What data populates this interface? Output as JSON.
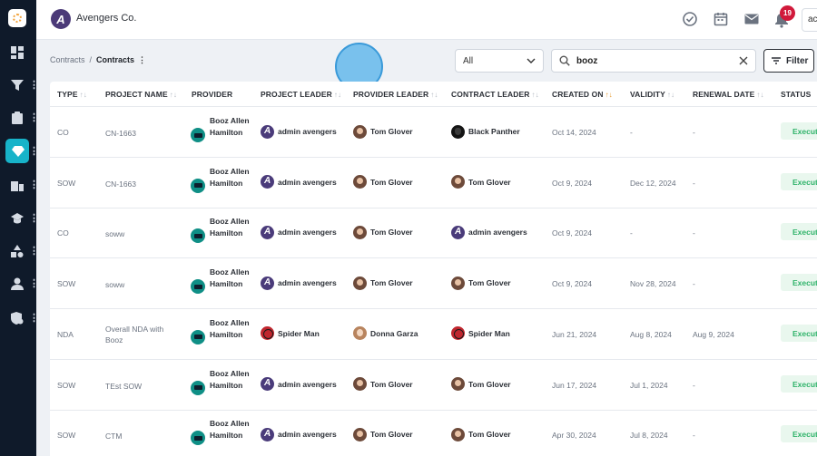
{
  "app": {
    "name": "Avengers Co."
  },
  "nav": {
    "items": [
      {
        "icon": "dashboard-icon"
      },
      {
        "icon": "funnel-icon"
      },
      {
        "icon": "clipboard-icon"
      },
      {
        "icon": "diamond-icon",
        "active": true
      },
      {
        "icon": "building-icon"
      },
      {
        "icon": "graduation-cap-icon"
      },
      {
        "icon": "shapes-icon"
      },
      {
        "icon": "user-icon"
      },
      {
        "icon": "shield-gear-icon"
      }
    ]
  },
  "header": {
    "notification_count": "19",
    "user_initials": "ac"
  },
  "breadcrumb": {
    "root": "Contracts",
    "separator": "/",
    "current": "Contracts"
  },
  "filters": {
    "type_select": "All",
    "search_value": "booz",
    "filter_label": "Filter"
  },
  "table": {
    "columns": [
      "TYPE",
      "PROJECT NAME",
      "PROVIDER",
      "PROJECT LEADER",
      "PROVIDER LEADER",
      "CONTRACT LEADER",
      "CREATED ON",
      "VALIDITY",
      "RENEWAL DATE",
      "STATUS"
    ],
    "rows": [
      {
        "type": "CO",
        "project": "CN-1663",
        "provider": "Booz Allen Hamilton",
        "project_leader": "admin avengers",
        "provider_leader": "Tom Glover",
        "contract_leader": "Black Panther",
        "created_on": "Oct 14, 2024",
        "validity": "-",
        "renewal": "-",
        "status": "Executed"
      },
      {
        "type": "SOW",
        "project": "CN-1663",
        "provider": "Booz Allen Hamilton",
        "project_leader": "admin avengers",
        "provider_leader": "Tom Glover",
        "contract_leader": "Tom Glover",
        "created_on": "Oct 9, 2024",
        "validity": "Dec 12, 2024",
        "renewal": "-",
        "status": "Executed"
      },
      {
        "type": "CO",
        "project": "soww",
        "provider": "Booz Allen Hamilton",
        "project_leader": "admin avengers",
        "provider_leader": "Tom Glover",
        "contract_leader": "admin avengers",
        "created_on": "Oct 9, 2024",
        "validity": "-",
        "renewal": "-",
        "status": "Executed"
      },
      {
        "type": "SOW",
        "project": "soww",
        "provider": "Booz Allen Hamilton",
        "project_leader": "admin avengers",
        "provider_leader": "Tom Glover",
        "contract_leader": "Tom Glover",
        "created_on": "Oct 9, 2024",
        "validity": "Nov 28, 2024",
        "renewal": "-",
        "status": "Executed"
      },
      {
        "type": "NDA",
        "project": "Overall NDA with Booz",
        "provider": "Booz Allen Hamilton",
        "project_leader": "Spider Man",
        "provider_leader": "Donna Garza",
        "contract_leader": "Spider Man",
        "created_on": "Jun 21, 2024",
        "validity": "Aug 8, 2024",
        "renewal": "Aug 9, 2024",
        "status": "Executed"
      },
      {
        "type": "SOW",
        "project": "TEst SOW",
        "provider": "Booz Allen Hamilton",
        "project_leader": "admin avengers",
        "provider_leader": "Tom Glover",
        "contract_leader": "Tom Glover",
        "created_on": "Jun 17, 2024",
        "validity": "Jul 1, 2024",
        "renewal": "-",
        "status": "Executed"
      },
      {
        "type": "SOW",
        "project": "CTM",
        "provider": "Booz Allen Hamilton",
        "project_leader": "admin avengers",
        "provider_leader": "Tom Glover",
        "contract_leader": "Tom Glover",
        "created_on": "Apr 30, 2024",
        "validity": "Jul 8, 2024",
        "renewal": "-",
        "status": "Executed"
      }
    ]
  }
}
